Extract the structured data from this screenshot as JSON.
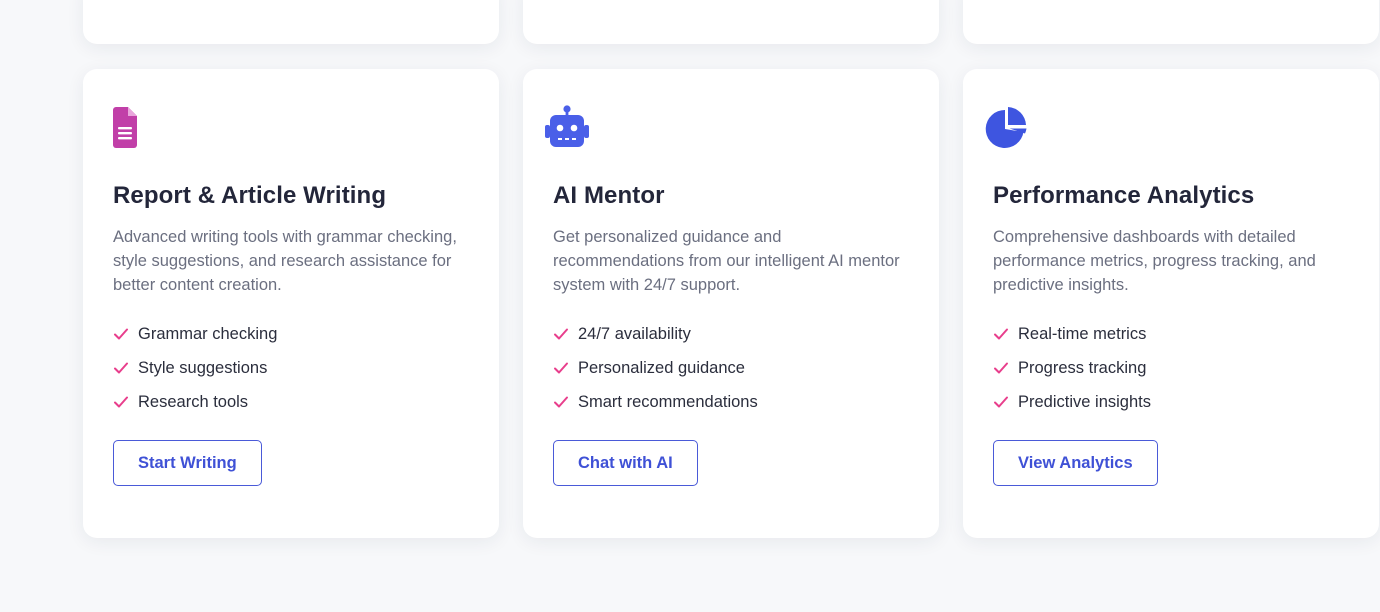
{
  "colors": {
    "accent": "#3f51d6",
    "check": "#e83e8c",
    "doc_icon": "#c13fa8",
    "robot_icon": "#4a5fe8",
    "chart_icon": "#3e55e0"
  },
  "cards": [
    {
      "icon": "document-icon",
      "title": "Report & Article Writing",
      "description": "Advanced writing tools with grammar checking, style suggestions, and research assistance for better content creation.",
      "features": [
        "Grammar checking",
        "Style suggestions",
        "Research tools"
      ],
      "button": "Start Writing"
    },
    {
      "icon": "robot-icon",
      "title": "AI Mentor",
      "description": "Get personalized guidance and recommendations from our intelligent AI mentor system with 24/7 support.",
      "features": [
        "24/7 availability",
        "Personalized guidance",
        "Smart recommendations"
      ],
      "button": "Chat with AI"
    },
    {
      "icon": "pie-chart-icon",
      "title": "Performance Analytics",
      "description": "Comprehensive dashboards with detailed performance metrics, progress tracking, and predictive insights.",
      "features": [
        "Real-time metrics",
        "Progress tracking",
        "Predictive insights"
      ],
      "button": "View Analytics"
    }
  ]
}
